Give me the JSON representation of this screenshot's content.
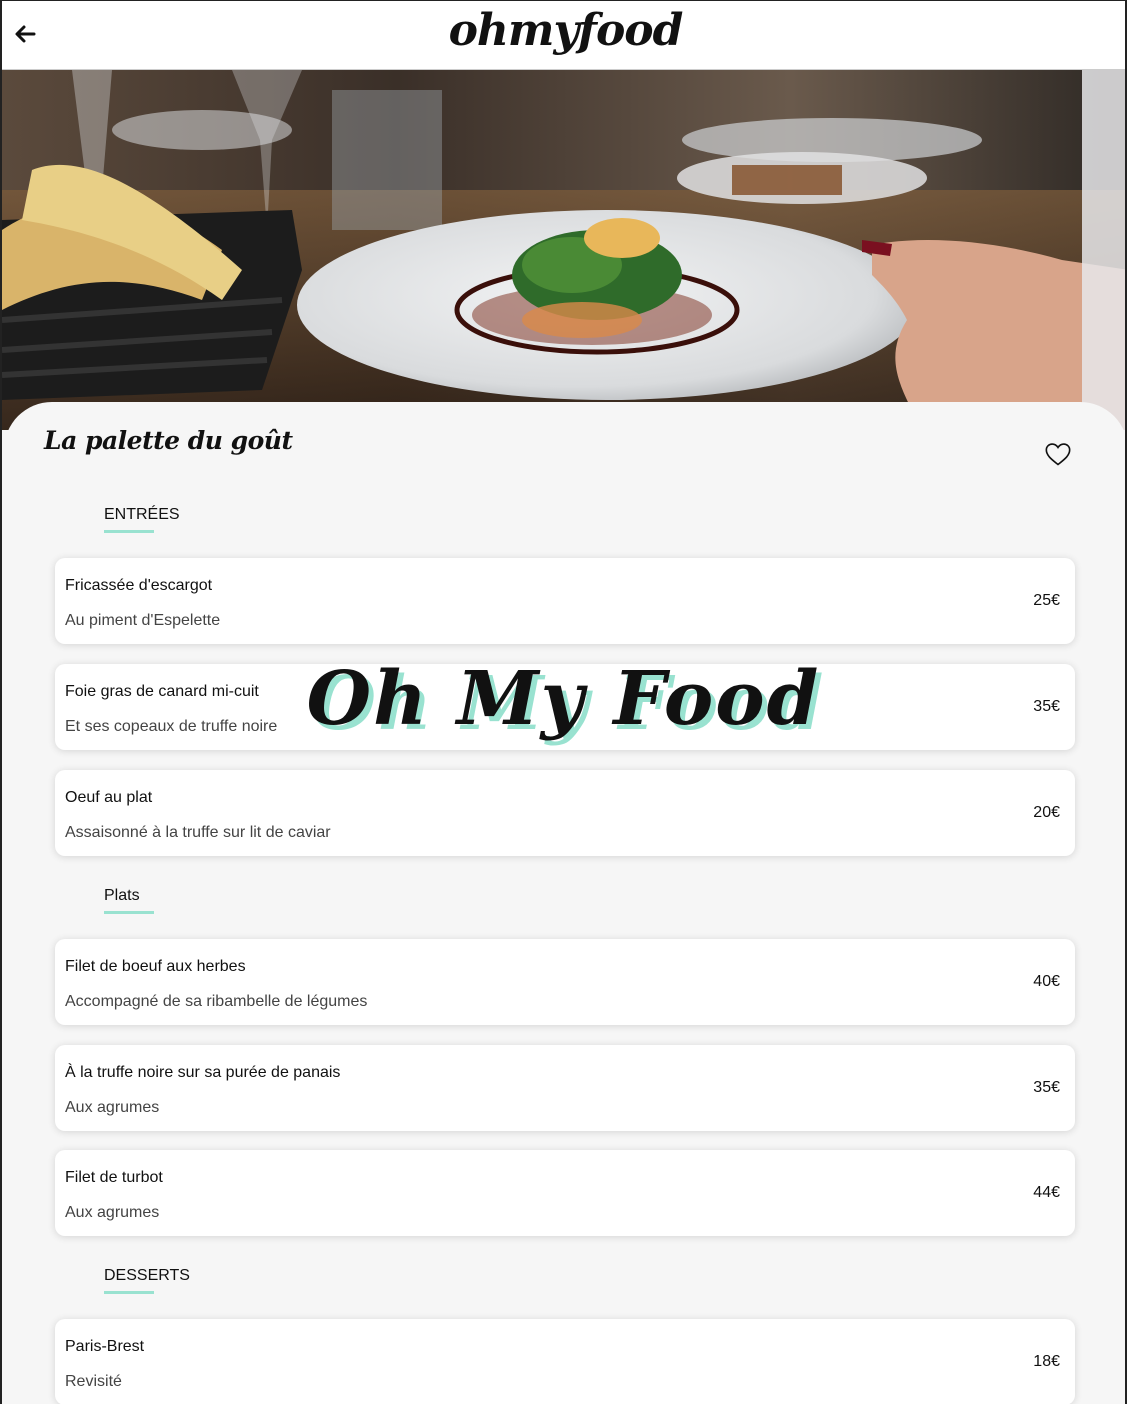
{
  "header": {
    "logo": "ohmyfood",
    "back_icon": "arrow-left-icon"
  },
  "hero": {
    "image": "restaurant-plate-photo"
  },
  "restaurant": {
    "name": "La palette du goût",
    "favorite_icon": "heart-outline-icon"
  },
  "overlay": {
    "title": "Oh My Food"
  },
  "colors": {
    "accent": "#99e2d0",
    "background": "#f6f6f6"
  },
  "sections": [
    {
      "title": "ENTRÉES",
      "items": [
        {
          "name": "Fricassée d'escargot",
          "description": "Au piment d'Espelette",
          "price": "25€"
        },
        {
          "name": "Foie gras de canard mi-cuit",
          "description": "Et ses copeaux de truffe noire",
          "price": "35€"
        },
        {
          "name": "Oeuf au plat",
          "description": "Assaisonné à la truffe sur lit de caviar",
          "price": "20€"
        }
      ]
    },
    {
      "title": "Plats",
      "items": [
        {
          "name": "Filet de boeuf aux herbes",
          "description": "Accompagné de sa ribambelle de légumes",
          "price": "40€"
        },
        {
          "name": "À la truffe noire sur sa purée de panais",
          "description": "Aux agrumes",
          "price": "35€"
        },
        {
          "name": "Filet de turbot",
          "description": "Aux agrumes",
          "price": "44€"
        }
      ]
    },
    {
      "title": "DESSERTS",
      "items": [
        {
          "name": "Paris-Brest",
          "description": "Revisité",
          "price": "18€"
        }
      ]
    }
  ]
}
